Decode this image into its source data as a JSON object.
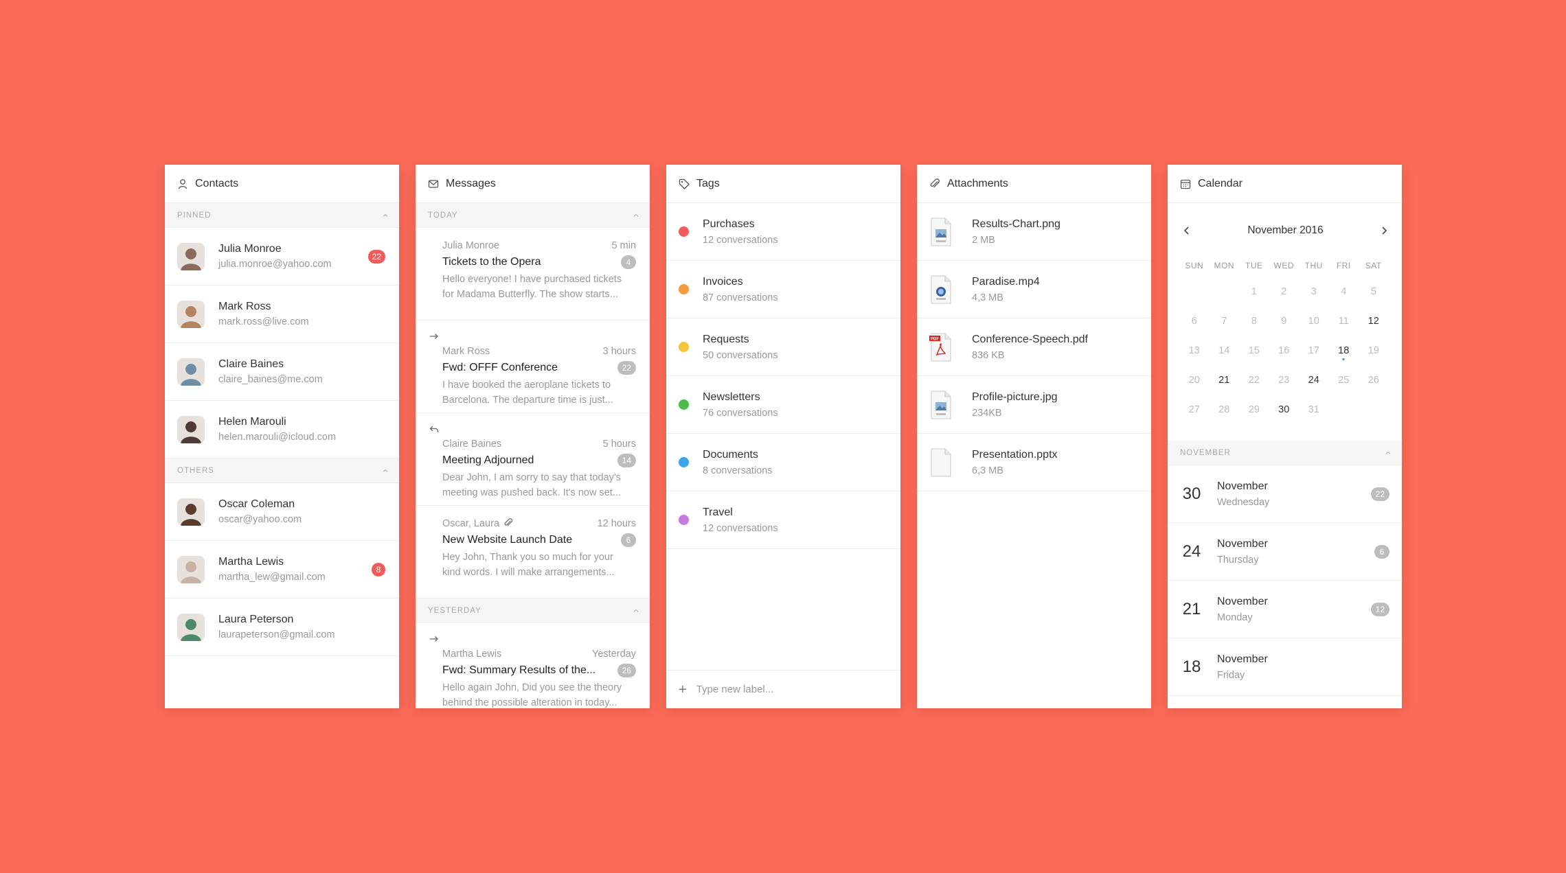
{
  "contacts": {
    "title": "Contacts",
    "pinned_label": "PINNED",
    "others_label": "OTHERS",
    "pinned": [
      {
        "name": "Julia Monroe",
        "email": "julia.monroe@yahoo.com",
        "badge": "22",
        "avatar_color": "#8a6a5a"
      },
      {
        "name": "Mark Ross",
        "email": "mark.ross@live.com",
        "badge": "",
        "avatar_color": "#b5835f"
      },
      {
        "name": "Claire Baines",
        "email": "claire_baines@me.com",
        "badge": "",
        "avatar_color": "#6f8ea6"
      },
      {
        "name": "Helen Marouli",
        "email": "helen.marouli@icloud.com",
        "badge": "",
        "avatar_color": "#4e3a36"
      }
    ],
    "others": [
      {
        "name": "Oscar Coleman",
        "email": "oscar@yahoo.com",
        "badge": "",
        "avatar_color": "#5a3b2c"
      },
      {
        "name": "Martha Lewis",
        "email": "martha_lew@gmail.com",
        "badge": "8",
        "avatar_color": "#c9b2a3"
      },
      {
        "name": "Laura Peterson",
        "email": "laurapeterson@gmail.com",
        "badge": "",
        "avatar_color": "#4d8a6b"
      }
    ]
  },
  "messages": {
    "title": "Messages",
    "today_label": "TODAY",
    "yesterday_label": "YESTERDAY",
    "today": [
      {
        "from": "Julia Monroe",
        "time": "5 min",
        "subject": "Tickets to the Opera",
        "count": "4",
        "unread": true,
        "indicator": "",
        "attachment": false,
        "preview1": "Hello everyone! I have purchased tickets",
        "preview2": "for Madama Butterfly. The show starts..."
      },
      {
        "from": "Mark Ross",
        "time": "3 hours",
        "subject": "Fwd: OFFF Conference",
        "count": "22",
        "unread": true,
        "indicator": "forward",
        "attachment": false,
        "preview1": "I have booked the aeroplane tickets to",
        "preview2": "Barcelona. The departure time is just..."
      },
      {
        "from": "Claire Baines",
        "time": "5 hours",
        "subject": "Meeting Adjourned",
        "count": "14",
        "unread": false,
        "indicator": "reply",
        "attachment": false,
        "preview1": "Dear John, I am sorry to say that today's",
        "preview2": "meeting was pushed back. It's now set..."
      },
      {
        "from": "Oscar, Laura",
        "time": "12 hours",
        "subject": "New Website Launch Date",
        "count": "6",
        "unread": false,
        "indicator": "",
        "attachment": true,
        "preview1": "Hey John, Thank you so much for your",
        "preview2": "kind words. I will make arrangements..."
      }
    ],
    "yesterday": [
      {
        "from": "Martha Lewis",
        "time": "Yesterday",
        "subject": "Fwd: Summary Results of the...",
        "count": "26",
        "unread": true,
        "indicator": "forward",
        "attachment": false,
        "preview1": "Hello again John, Did you see the theory",
        "preview2": "behind the possible alteration in today..."
      }
    ]
  },
  "tags": {
    "title": "Tags",
    "items": [
      {
        "name": "Purchases",
        "count": "12 conversations",
        "color": "#f05b5b"
      },
      {
        "name": "Invoices",
        "count": "87 conversations",
        "color": "#f59a3c"
      },
      {
        "name": "Requests",
        "count": "50 conversations",
        "color": "#f3c53a"
      },
      {
        "name": "Newsletters",
        "count": "76 conversations",
        "color": "#4cbb4a"
      },
      {
        "name": "Documents",
        "count": "8 conversations",
        "color": "#3aa6e8"
      },
      {
        "name": "Travel",
        "count": "12 conversations",
        "color": "#c57ae0"
      }
    ],
    "new_label_placeholder": "Type new label..."
  },
  "attachments": {
    "title": "Attachments",
    "items": [
      {
        "name": "Results-Chart.png",
        "size": "2 MB",
        "icon": "png-file-icon"
      },
      {
        "name": "Paradise.mp4",
        "size": "4,3 MB",
        "icon": "video-file-icon"
      },
      {
        "name": "Conference-Speech.pdf",
        "size": "836 KB",
        "icon": "pdf-file-icon"
      },
      {
        "name": "Profile-picture.jpg",
        "size": "234KB",
        "icon": "jpg-file-icon"
      },
      {
        "name": "Presentation.pptx",
        "size": "6,3 MB",
        "icon": "blank-file-icon"
      }
    ]
  },
  "calendar": {
    "title": "Calendar",
    "month_label": "November 2016",
    "weekdays": [
      "SUN",
      "MON",
      "TUE",
      "WED",
      "THU",
      "FRI",
      "SAT"
    ],
    "weeks": [
      [
        "",
        "",
        "1",
        "2",
        "3",
        "4",
        "5"
      ],
      [
        "6",
        "7",
        "8",
        "9",
        "10",
        "11",
        "12"
      ],
      [
        "13",
        "14",
        "15",
        "16",
        "17",
        "18",
        "19"
      ],
      [
        "20",
        "21",
        "22",
        "23",
        "24",
        "25",
        "26"
      ],
      [
        "27",
        "28",
        "29",
        "30",
        "31",
        "",
        ""
      ]
    ],
    "highlighted_days": [
      "12",
      "18",
      "21",
      "24",
      "30"
    ],
    "selected_day": "18",
    "section_label": "NOVEMBER",
    "events": [
      {
        "day": "30",
        "month": "November",
        "weekday": "Wednesday",
        "count": "22"
      },
      {
        "day": "24",
        "month": "November",
        "weekday": "Thursday",
        "count": "6"
      },
      {
        "day": "21",
        "month": "November",
        "weekday": "Monday",
        "count": "12"
      },
      {
        "day": "18",
        "month": "November",
        "weekday": "Friday",
        "count": ""
      }
    ]
  }
}
